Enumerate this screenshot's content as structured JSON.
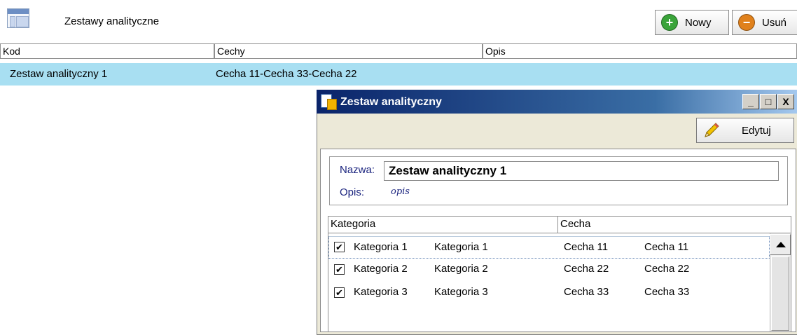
{
  "toolbar": {
    "title": "Zestawy analityczne",
    "new_label": "Nowy",
    "delete_label": "Usuń"
  },
  "table": {
    "columns": [
      "Kod",
      "Cechy",
      "Opis"
    ],
    "rows": [
      {
        "kod": "Zestaw analityczny 1",
        "cechy": "Cecha 11-Cecha 33-Cecha 22",
        "opis": ""
      }
    ]
  },
  "dialog": {
    "title": "Zestaw analityczny",
    "window_buttons": {
      "min": "_",
      "max": "□",
      "close": "X"
    },
    "edit_label": "Edytuj",
    "name_label": "Nazwa:",
    "name_value": "Zestaw analityczny 1",
    "desc_label": "Opis:",
    "desc_value": "opis",
    "grid": {
      "columns": [
        "Kategoria",
        "Cecha"
      ],
      "rows": [
        {
          "checked": true,
          "kat1": "Kategoria 1",
          "kat2": "Kategoria 1",
          "cecha1": "Cecha 11",
          "cecha2": "Cecha 11"
        },
        {
          "checked": true,
          "kat1": "Kategoria 2",
          "kat2": "Kategoria 2",
          "cecha1": "Cecha 22",
          "cecha2": "Cecha 22"
        },
        {
          "checked": true,
          "kat1": "Kategoria 3",
          "kat2": "Kategoria 3",
          "cecha1": "Cecha 33",
          "cecha2": "Cecha 33"
        }
      ]
    }
  },
  "colors": {
    "selected_row": "#a8dff2",
    "title_bar": "#0a246a",
    "label_blue": "#1a237e",
    "new_icon": "#3aa43a",
    "delete_icon": "#e0811c"
  },
  "icons": {
    "app": "table-icon",
    "new": "plus-circle-icon",
    "delete": "minus-circle-icon",
    "edit": "pencil-icon",
    "dialog": "document-icon"
  }
}
